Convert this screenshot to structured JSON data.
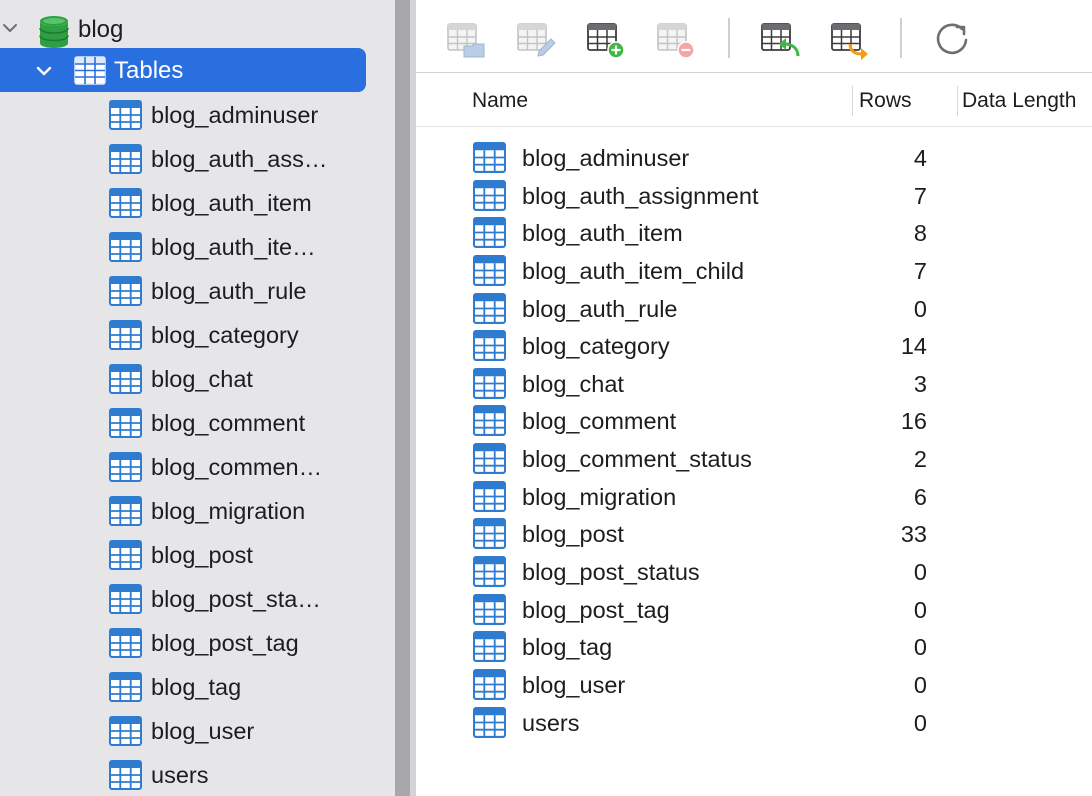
{
  "sidebar": {
    "database": {
      "label": "blog",
      "icon": "database-icon"
    },
    "tables_group": {
      "label": "Tables",
      "icon": "tables-icon",
      "expanded": true,
      "selected": true
    },
    "items": [
      {
        "label": "blog_adminuser"
      },
      {
        "label": "blog_auth_ass…"
      },
      {
        "label": "blog_auth_item"
      },
      {
        "label": "blog_auth_ite…"
      },
      {
        "label": "blog_auth_rule"
      },
      {
        "label": "blog_category"
      },
      {
        "label": "blog_chat"
      },
      {
        "label": "blog_comment"
      },
      {
        "label": "blog_commen…"
      },
      {
        "label": "blog_migration"
      },
      {
        "label": "blog_post"
      },
      {
        "label": "blog_post_sta…"
      },
      {
        "label": "blog_post_tag"
      },
      {
        "label": "blog_tag"
      },
      {
        "label": "blog_user"
      },
      {
        "label": "users"
      }
    ]
  },
  "toolbar": {
    "buttons": [
      {
        "name": "open-table-button",
        "icon": "table-folder-icon",
        "enabled": false
      },
      {
        "name": "edit-table-button",
        "icon": "table-pencil-icon",
        "enabled": false
      },
      {
        "name": "add-table-button",
        "icon": "table-add-icon",
        "enabled": true
      },
      {
        "name": "delete-table-button",
        "icon": "table-remove-icon",
        "enabled": false
      },
      {
        "name": "import-button",
        "icon": "table-import-icon",
        "enabled": true
      },
      {
        "name": "export-button",
        "icon": "table-export-icon",
        "enabled": true
      },
      {
        "name": "refresh-button",
        "icon": "refresh-icon",
        "enabled": true
      }
    ]
  },
  "table": {
    "columns": {
      "name": "Name",
      "rows": "Rows",
      "data_length": "Data Length"
    },
    "rows": [
      {
        "name": "blog_adminuser",
        "rows": "4"
      },
      {
        "name": "blog_auth_assignment",
        "rows": "7"
      },
      {
        "name": "blog_auth_item",
        "rows": "8"
      },
      {
        "name": "blog_auth_item_child",
        "rows": "7"
      },
      {
        "name": "blog_auth_rule",
        "rows": "0"
      },
      {
        "name": "blog_category",
        "rows": "14"
      },
      {
        "name": "blog_chat",
        "rows": "3"
      },
      {
        "name": "blog_comment",
        "rows": "16"
      },
      {
        "name": "blog_comment_status",
        "rows": "2"
      },
      {
        "name": "blog_migration",
        "rows": "6"
      },
      {
        "name": "blog_post",
        "rows": "33"
      },
      {
        "name": "blog_post_status",
        "rows": "0"
      },
      {
        "name": "blog_post_tag",
        "rows": "0"
      },
      {
        "name": "blog_tag",
        "rows": "0"
      },
      {
        "name": "blog_user",
        "rows": "0"
      },
      {
        "name": "users",
        "rows": "0"
      }
    ]
  },
  "colors": {
    "selection": "#2a6fdf",
    "sidebar_bg": "#e6e6e8",
    "table_icon": "#2f7bd0",
    "database_icon": "#2ea043",
    "add_badge": "#3fb843",
    "remove_badge": "#f08a8a",
    "import_arrow": "#3fb843",
    "export_arrow": "#f39c12"
  }
}
